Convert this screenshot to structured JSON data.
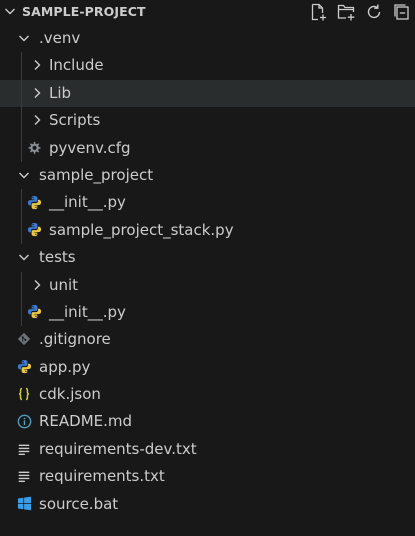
{
  "explorer": {
    "title": "SAMPLE-PROJECT",
    "actions": [
      {
        "name": "new-file-icon",
        "tooltip": "New File..."
      },
      {
        "name": "new-folder-icon",
        "tooltip": "New Folder..."
      },
      {
        "name": "refresh-icon",
        "tooltip": "Refresh Explorer"
      },
      {
        "name": "collapse-all-icon",
        "tooltip": "Collapse Folders in Explorer"
      }
    ],
    "items": [
      {
        "label": ".venv",
        "type": "folder",
        "expanded": true,
        "depth": 0
      },
      {
        "label": "Include",
        "type": "folder",
        "expanded": false,
        "depth": 1
      },
      {
        "label": "Lib",
        "type": "folder",
        "expanded": false,
        "depth": 1,
        "selected": true
      },
      {
        "label": "Scripts",
        "type": "folder",
        "expanded": false,
        "depth": 1
      },
      {
        "label": "pyvenv.cfg",
        "type": "file",
        "icon": "gear-icon",
        "depth": 1
      },
      {
        "label": "sample_project",
        "type": "folder",
        "expanded": true,
        "depth": 0
      },
      {
        "label": "__init__.py",
        "type": "file",
        "icon": "python-icon",
        "depth": 1
      },
      {
        "label": "sample_project_stack.py",
        "type": "file",
        "icon": "python-icon",
        "depth": 1
      },
      {
        "label": "tests",
        "type": "folder",
        "expanded": true,
        "depth": 0
      },
      {
        "label": "unit",
        "type": "folder",
        "expanded": false,
        "depth": 1
      },
      {
        "label": "__init__.py",
        "type": "file",
        "icon": "python-icon",
        "depth": 1
      },
      {
        "label": ".gitignore",
        "type": "file",
        "icon": "git-icon",
        "depth": 0
      },
      {
        "label": "app.py",
        "type": "file",
        "icon": "python-icon",
        "depth": 0
      },
      {
        "label": "cdk.json",
        "type": "file",
        "icon": "json-icon",
        "depth": 0
      },
      {
        "label": "README.md",
        "type": "file",
        "icon": "info-icon",
        "depth": 0
      },
      {
        "label": "requirements-dev.txt",
        "type": "file",
        "icon": "text-file-icon",
        "depth": 0
      },
      {
        "label": "requirements.txt",
        "type": "file",
        "icon": "text-file-icon",
        "depth": 0
      },
      {
        "label": "source.bat",
        "type": "file",
        "icon": "windows-icon",
        "depth": 0
      }
    ]
  },
  "colors": {
    "background": "#181818",
    "text": "#cccccc",
    "selected_row": "#2a2d2e",
    "indent_guide": "#3c3c3c",
    "python_blue": "#3c7bd0",
    "python_yellow": "#e8c547",
    "json_yellow": "#cbcb41",
    "info_blue": "#519aba",
    "windows_blue": "#3b9de8",
    "git_gray": "#6d7178"
  }
}
